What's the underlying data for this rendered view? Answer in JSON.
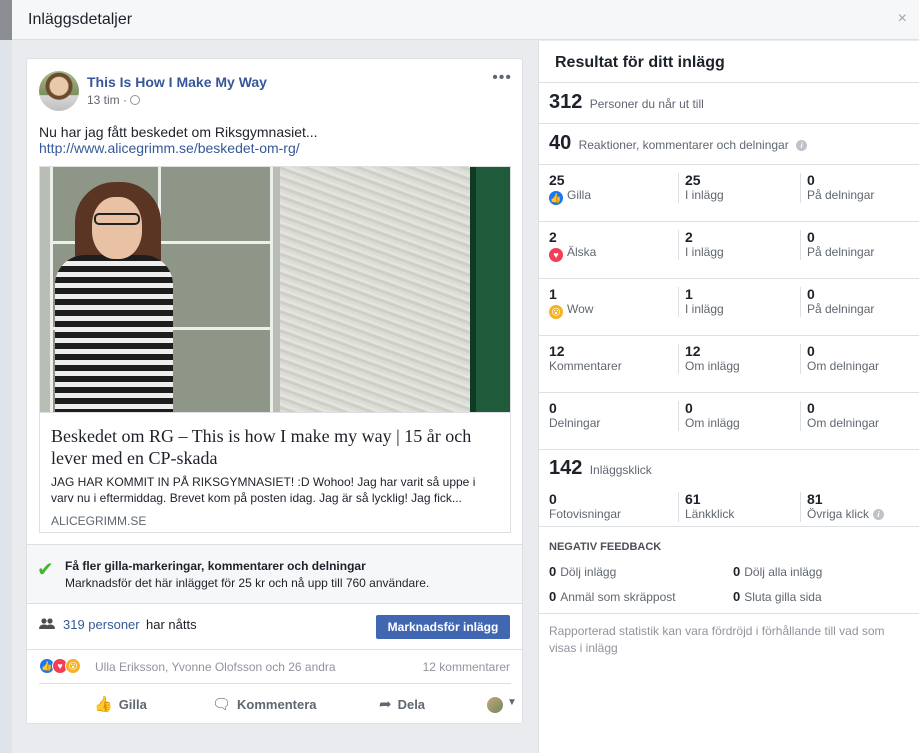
{
  "dialog": {
    "title": "Inläggsdetaljer",
    "close_label": "×"
  },
  "post": {
    "page_name": "This Is How I Make My Way",
    "time": "13 tim",
    "meta_sep": "·",
    "more_label": "•••",
    "text": "Nu har jag fått beskedet om Riksgymnasiet...",
    "link_text": "http://www.alicegrimm.se/beskedet-om-rg/",
    "preview": {
      "title": "Beskedet om RG – This is how I make my way | 15 år och lever med en CP-skada",
      "description": "JAG HAR KOMMIT IN PÅ RIKSGYMNASIET! :D Wohoo! Jag har varit så uppe i varv nu i eftermiddag. Brevet kom på posten idag. Jag är så lycklig! Jag fick...",
      "domain": "ALICEGRIMM.SE"
    },
    "promo": {
      "title": "Få fler gilla-markeringar, kommentarer och delningar",
      "description": "Marknadsför det här inlägget för 25 kr och nå upp till 760 användare."
    },
    "reach": {
      "count_text": "319 personer",
      "suffix": "har nåtts",
      "boost_label": "Marknadsför inlägg"
    },
    "reactions": {
      "names": "Ulla Eriksson, Yvonne Olofsson och 26 andra",
      "comments": "12 kommentarer"
    },
    "actions": {
      "like": "Gilla",
      "comment": "Kommentera",
      "share": "Dela"
    }
  },
  "insights": {
    "title": "Resultat för ditt inlägg",
    "reach": {
      "value": "312",
      "label": "Personer du når ut till"
    },
    "engagement": {
      "value": "40",
      "label": "Reaktioner, kommentarer och delningar"
    },
    "rows": [
      {
        "c1": {
          "value": "25",
          "label": "Gilla"
        },
        "c2": {
          "value": "25",
          "label": "I inlägg"
        },
        "c3": {
          "value": "0",
          "label": "På delningar"
        }
      },
      {
        "c1": {
          "value": "2",
          "label": "Älska"
        },
        "c2": {
          "value": "2",
          "label": "I inlägg"
        },
        "c3": {
          "value": "0",
          "label": "På delningar"
        }
      },
      {
        "c1": {
          "value": "1",
          "label": "Wow"
        },
        "c2": {
          "value": "1",
          "label": "I inlägg"
        },
        "c3": {
          "value": "0",
          "label": "På delningar"
        }
      },
      {
        "c1": {
          "value": "12",
          "label": "Kommentarer"
        },
        "c2": {
          "value": "12",
          "label": "Om inlägg"
        },
        "c3": {
          "value": "0",
          "label": "Om delningar"
        }
      },
      {
        "c1": {
          "value": "0",
          "label": "Delningar"
        },
        "c2": {
          "value": "0",
          "label": "Om inlägg"
        },
        "c3": {
          "value": "0",
          "label": "Om delningar"
        }
      }
    ],
    "clicks": {
      "value": "142",
      "label": "Inläggsklick",
      "c1": {
        "value": "0",
        "label": "Fotovisningar"
      },
      "c2": {
        "value": "61",
        "label": "Länkklick"
      },
      "c3": {
        "value": "81",
        "label": "Övriga klick"
      }
    },
    "negative": {
      "heading": "NEGATIV FEEDBACK",
      "items": [
        {
          "value": "0",
          "label": "Dölj inlägg"
        },
        {
          "value": "0",
          "label": "Dölj alla inlägg"
        },
        {
          "value": "0",
          "label": "Anmäl som skräppost"
        },
        {
          "value": "0",
          "label": "Sluta gilla sida"
        }
      ]
    },
    "footnote": "Rapporterad statistik kan vara fördröjd i förhållande till vad som visas i inlägg"
  },
  "colors": {
    "brand": "#4267b2",
    "link": "#365899",
    "like": "#1877f2",
    "love": "#f33e58",
    "wow": "#f7b125",
    "check": "#42b72a"
  },
  "icons": [
    "close-icon",
    "globe-icon",
    "more-icon",
    "check-icon",
    "people-icon",
    "like-icon",
    "love-icon",
    "wow-icon",
    "comment-icon",
    "share-icon",
    "info-icon",
    "caret-down-icon"
  ]
}
